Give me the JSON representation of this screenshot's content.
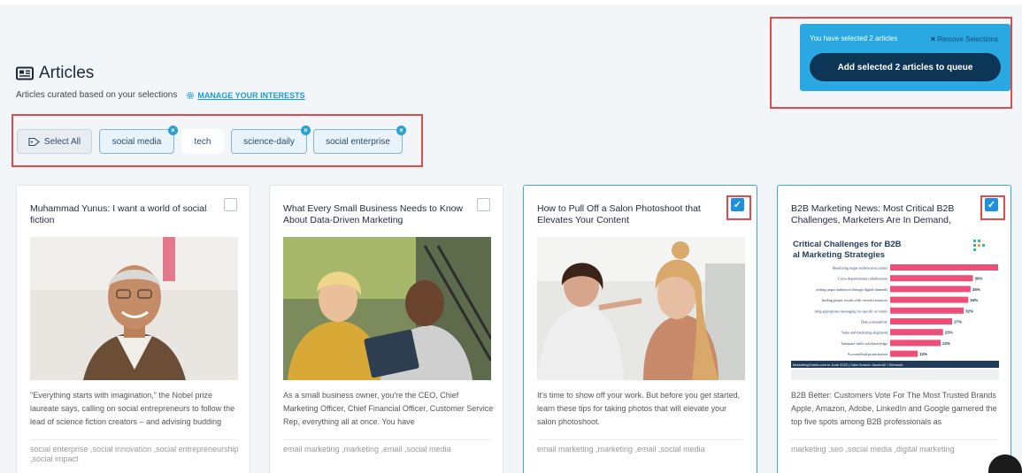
{
  "header": {
    "title": "Articles",
    "subtitle": "Articles curated based on your selections",
    "manage_link": "MANAGE YOUR INTERESTS"
  },
  "filters": {
    "select_all": "Select All",
    "chips": [
      {
        "label": "social media",
        "removable": true
      },
      {
        "label": "tech",
        "removable": false
      },
      {
        "label": "science-daily",
        "removable": true
      },
      {
        "label": "social enterprise",
        "removable": true
      }
    ]
  },
  "selection": {
    "count_text": "You have selected 2 articles",
    "remove_label": "Remove Selections",
    "queue_button": "Add selected 2 articles to queue"
  },
  "articles": [
    {
      "title": "Muhammad Yunus: I want a world of social fiction",
      "description": "\"Everything starts with imagination,\" the Nobel prize laureate says, calling on social entrepreneurs to follow the lead of science fiction creators – and advising budding",
      "tags": "social enterprise ,social innovation ,social entrepreneurship ,social impact",
      "selected": false
    },
    {
      "title": "What Every Small Business Needs to Know About Data-Driven Marketing",
      "description": "As a small business owner, you're the CEO, Chief Marketing Officer, Chief Financial Officer, Customer Service Rep, everything all at once. You have",
      "tags": "email marketing ,marketing ,email ,social media",
      "selected": false
    },
    {
      "title": "How to Pull Off a Salon Photoshoot that Elevates Your Content",
      "description": "It's time to show off your work. But before you get started, learn these tips for taking photos that will elevate your salon photoshoot.",
      "tags": "email marketing ,marketing ,email ,social media",
      "selected": true
    },
    {
      "title": "B2B Marketing News: Most Critical B2B Challenges, Marketers Are In Demand,",
      "description": "B2B Better: Customers Vote For The Most Trusted Brands Apple, Amazon, Adobe, LinkedIn and Google garnered the top five spots among B2B professionals as",
      "tags": "marketing ,seo ,social media ,digital marketing",
      "selected": true
    }
  ],
  "infographic": {
    "title_line1": "Critical Challenges for B2B",
    "title_line2": "al Marketing Strategies",
    "rows": [
      {
        "label": "Identifying target audiences/accounts",
        "value": 47,
        "text": ""
      },
      {
        "label": "Cross-departmental collaboration",
        "value": 36,
        "text": "36%"
      },
      {
        "label": "aching target audiences through digital channels",
        "value": 35,
        "text": "35%"
      },
      {
        "label": "finding proper results with current resources",
        "value": 34,
        "text": "34%"
      },
      {
        "label": "king appropriate messaging for specific accounts",
        "value": 32,
        "text": "32%"
      },
      {
        "label": "Data actionability",
        "value": 27,
        "text": "27%"
      },
      {
        "label": "Sales and marketing alignment",
        "value": 23,
        "text": "23%"
      },
      {
        "label": "Adequate skills sets/knowledge",
        "value": 22,
        "text": "22%"
      },
      {
        "label": "Account/lead prioritization",
        "value": 12,
        "text": "12%"
      }
    ],
    "footer": "MarketingCharts.com in June 2022 | Data Source: Ascend2 / Semrush",
    "colors": {
      "bar": "#ee4f78",
      "title": "#1f3b58",
      "footer_band": "#1f3b58"
    }
  },
  "colors": {
    "accent": "#29a8e2",
    "button_dark": "#0d3556",
    "highlight_outline": "#e14b4b",
    "checkbox_checked": "#1e90dd"
  },
  "icons": {
    "title_icon": "newspaper-icon",
    "manage_icon": "gear-icon",
    "select_all_icon": "tag-icon",
    "chip_remove_icon": "close-icon",
    "remove_selection_icon": "close-icon",
    "checkbox_icon": "check-icon"
  }
}
